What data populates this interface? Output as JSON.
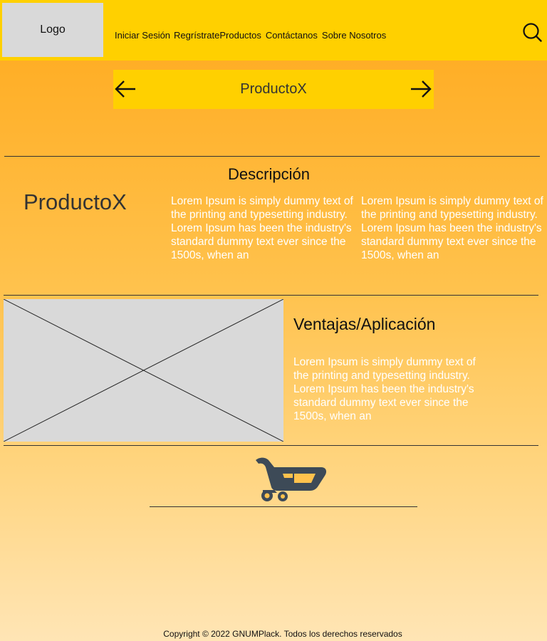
{
  "header": {
    "logo": "Logo",
    "nav": [
      "Iniciar Sesión",
      "Regrístrate",
      "Productos",
      "Contáctanos",
      "Sobre Nosotros"
    ],
    "icon": "search-icon"
  },
  "carousel": {
    "title": "ProductoX",
    "icons": [
      "arrow-left-icon",
      "arrow-right-icon"
    ]
  },
  "description": {
    "heading": "Descripción",
    "product_name": "ProductoX",
    "text_col1": "Lorem Ipsum is simply dummy text of the printing and typesetting industry. Lorem Ipsum has been the industry's standard dummy text ever since the 1500s, when an",
    "text_col2": "Lorem Ipsum is simply dummy text of the printing and typesetting industry. Lorem Ipsum has been the industry's standard dummy text ever since the 1500s, when an"
  },
  "advantages": {
    "heading": "Ventajas/Aplicación",
    "text": "Lorem Ipsum is simply dummy text of the printing and typesetting industry. Lorem Ipsum has been the industry's standard dummy text ever since the 1500s, when an"
  },
  "cart": {
    "icon": "shopping-cart-icon"
  },
  "footer": {
    "copyright": "Copyright © 2022 GNUMPlack. Todos los derechos reservados"
  },
  "colors": {
    "header_bg": "#FFD000",
    "gradient_top": "#FFA91C",
    "gradient_bottom": "#FFE5B5",
    "placeholder": "#D9D9D9",
    "cart": "#3D4A57"
  }
}
